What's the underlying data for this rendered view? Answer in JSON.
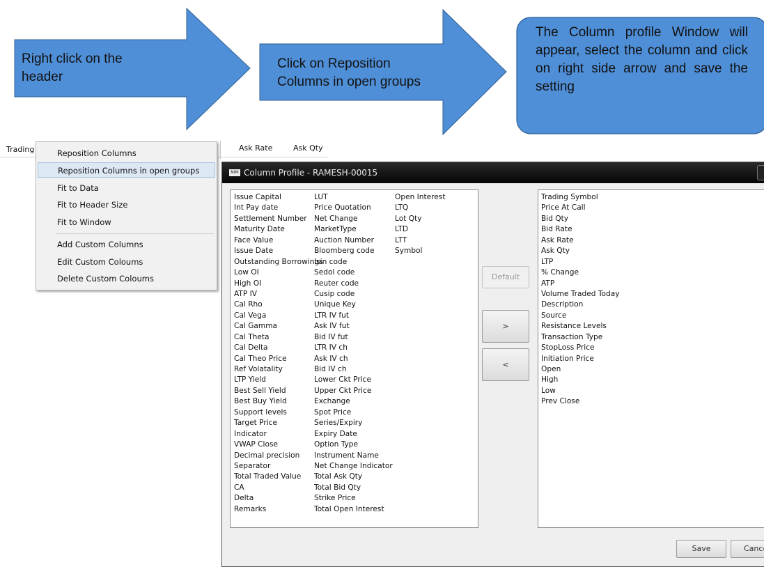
{
  "callouts": {
    "step1": "Right click on the header",
    "step2": "Click on Reposition Columns in open groups",
    "step3": "The Column profile Window will appear, select the column and click on right side arrow and save the setting"
  },
  "header": {
    "col_trading": "Trading",
    "col_ask_rate": "Ask Rate",
    "col_ask_qty": "Ask Qty"
  },
  "context_menu": {
    "items": [
      "Reposition Columns",
      "Reposition Columns in open groups",
      "Fit to Data",
      "Fit to Header Size",
      "Fit to Window",
      "Add Custom Columns",
      "Edit Custom Coloums",
      "Delete Custom Coloums"
    ]
  },
  "window": {
    "title": "Column Profile - RAMESH-00015",
    "icon_label": "NIM",
    "available_columns": {
      "col1": [
        "Issue Capital",
        "Int Pay  date",
        "Settlement Number",
        "Maturity Date",
        "Face Value",
        "Issue Date",
        "Outstanding Borrowings",
        "Low OI",
        "High OI",
        "ATP IV",
        "Cal Rho",
        "Cal Vega",
        "Cal Gamma",
        "Cal Theta",
        "Cal Delta",
        "Cal Theo Price",
        "Ref Volatality",
        "LTP Yield",
        "Best Sell Yield",
        "Best Buy Yield",
        "Support levels",
        "Target Price",
        "Indicator",
        "VWAP Close",
        "Decimal precision",
        "Separator",
        "Total Traded Value",
        "CA",
        "Delta",
        "Remarks"
      ],
      "col2": [
        "LUT",
        "Price  Quotation",
        "Net Change",
        "MarketType",
        "Auction Number",
        "Bloomberg code",
        "Isin code",
        "Sedol code",
        "Reuter code",
        "Cusip code",
        "Unique Key",
        "LTR IV fut",
        "Ask IV fut",
        "Bid IV fut",
        "LTR IV ch",
        "Ask IV ch",
        "Bid IV ch",
        "Lower Ckt Price",
        "Upper Ckt Price",
        "Exchange",
        "Spot Price",
        "Series/Expiry",
        "Expiry Date",
        "Option Type",
        "Instrument Name",
        "Net Change Indicator",
        "Total Ask Qty",
        "Total Bid Qty",
        "Strike Price",
        "Total Open Interest"
      ],
      "col3": [
        "Open Interest",
        "LTQ",
        "Lot Qty",
        "LTD",
        "LTT",
        "Symbol"
      ]
    },
    "selected_columns": [
      "Trading Symbol",
      "Price At Call",
      "Bid Qty",
      "Bid Rate",
      "Ask Rate",
      "Ask Qty",
      "LTP",
      "% Change",
      "ATP",
      "Volume Traded Today",
      "Description",
      "Source",
      "Resistance Levels",
      "Transaction Type",
      "StopLoss Price",
      "Initiation Price",
      "Open",
      "High",
      "Low",
      "Prev Close"
    ],
    "buttons": {
      "default": "Default",
      "move_right": ">",
      "move_left": "<",
      "save": "Save",
      "cancel": "Cance"
    }
  },
  "colors": {
    "callout_fill": "#4f8fd7",
    "callout_border": "#2f5f96",
    "title_bar": "#0c0c0c",
    "menu_highlight": "#dde8f5"
  }
}
